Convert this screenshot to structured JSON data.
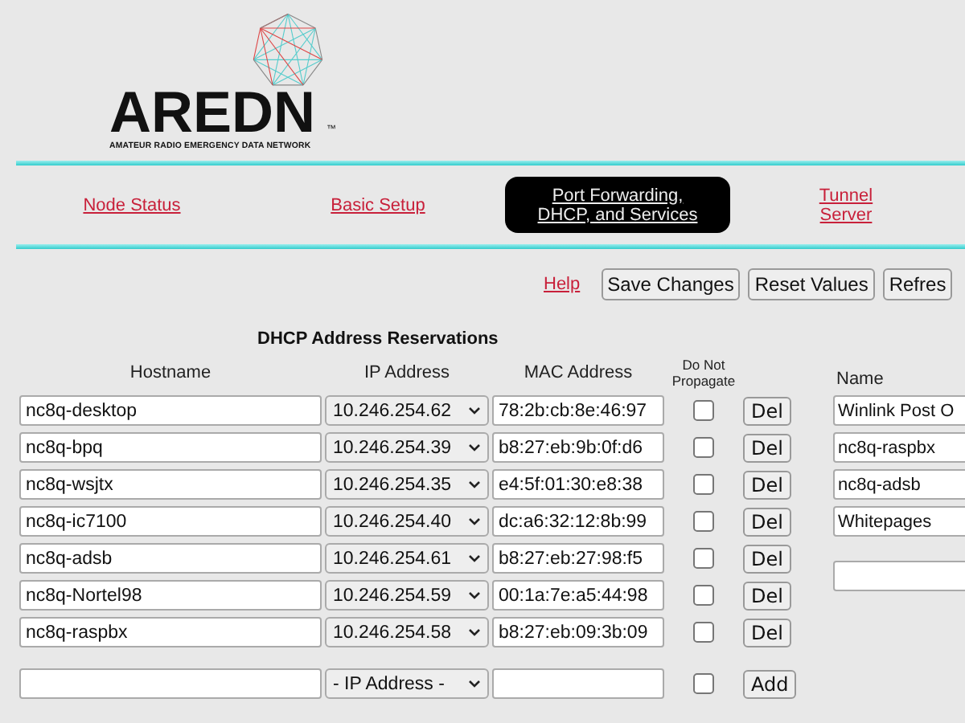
{
  "logo": {
    "wordmark": "AREDN",
    "trademark": "™",
    "tagline": "AMATEUR RADIO EMERGENCY DATA NETWORK"
  },
  "nav": [
    {
      "label": "Node Status",
      "selected": false
    },
    {
      "label": "Basic Setup",
      "selected": false
    },
    {
      "label": "Port Forwarding, DHCP, and Services",
      "selected": true
    },
    {
      "label": "Tunnel Server",
      "selected": false
    }
  ],
  "actions": {
    "help": "Help",
    "buttons": [
      "Save Changes",
      "Reset Values",
      "Refres"
    ]
  },
  "dhcp": {
    "title": "DHCP Address Reservations",
    "columns": [
      "Hostname",
      "IP Address",
      "MAC Address",
      "Do Not Propagate"
    ],
    "rows": [
      {
        "hostname": "nc8q-desktop",
        "ip": "10.246.254.62",
        "mac": "78:2b:cb:8e:46:97",
        "do_not_propagate": false,
        "action": "Del"
      },
      {
        "hostname": "nc8q-bpq",
        "ip": "10.246.254.39",
        "mac": "b8:27:eb:9b:0f:d6",
        "do_not_propagate": false,
        "action": "Del"
      },
      {
        "hostname": "nc8q-wsjtx",
        "ip": "10.246.254.35",
        "mac": "e4:5f:01:30:e8:38",
        "do_not_propagate": false,
        "action": "Del"
      },
      {
        "hostname": "nc8q-ic7100",
        "ip": "10.246.254.40",
        "mac": "dc:a6:32:12:8b:99",
        "do_not_propagate": false,
        "action": "Del"
      },
      {
        "hostname": "nc8q-adsb",
        "ip": "10.246.254.61",
        "mac": "b8:27:eb:27:98:f5",
        "do_not_propagate": false,
        "action": "Del"
      },
      {
        "hostname": "nc8q-Nortel98",
        "ip": "10.246.254.59",
        "mac": "00:1a:7e:a5:44:98",
        "do_not_propagate": false,
        "action": "Del"
      },
      {
        "hostname": "nc8q-raspbx",
        "ip": "10.246.254.58",
        "mac": "b8:27:eb:09:3b:09",
        "do_not_propagate": false,
        "action": "Del"
      }
    ],
    "new_row": {
      "ip": "- IP Address -",
      "do_not_propagate": false,
      "action": "Add"
    }
  },
  "services": {
    "column": "Name",
    "names": [
      "Winlink Post O",
      "nc8q-raspbx",
      "nc8q-adsb",
      "Whitepages"
    ]
  }
}
